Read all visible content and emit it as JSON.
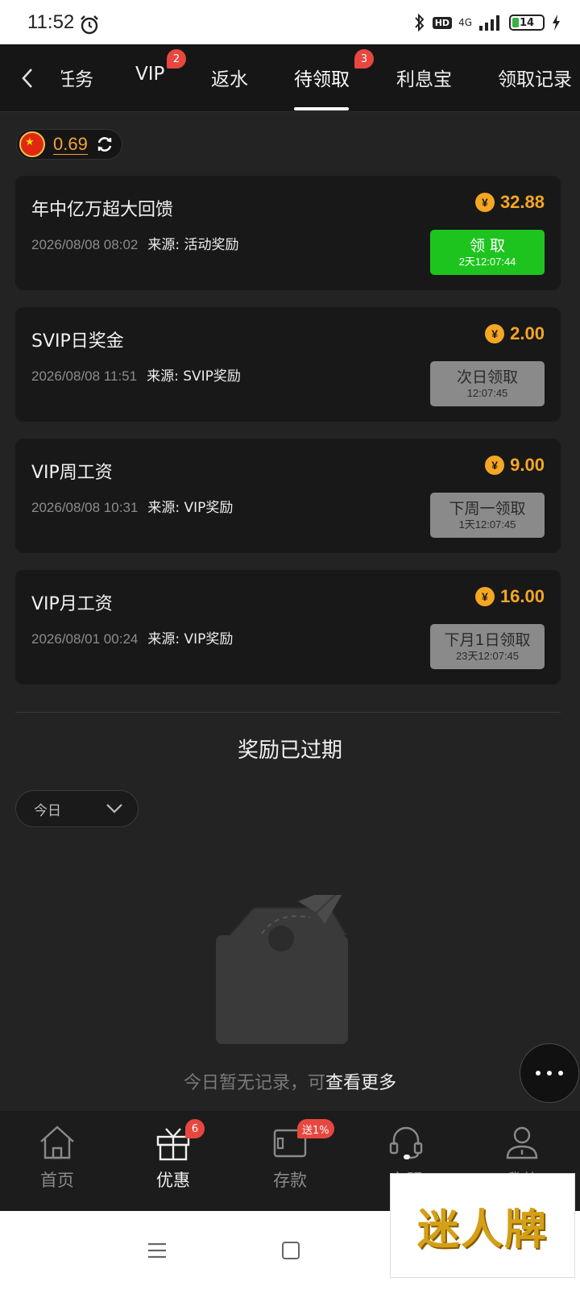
{
  "status_bar": {
    "time": "11:52",
    "network": "4G",
    "hd": "HD",
    "battery": "14"
  },
  "header": {
    "tabs": [
      {
        "label": "任务"
      },
      {
        "label": "VIP",
        "badge": "2"
      },
      {
        "label": "返水"
      },
      {
        "label": "待领取",
        "badge": "3",
        "active": true
      },
      {
        "label": "利息宝"
      },
      {
        "label": "领取记录"
      }
    ]
  },
  "balance": {
    "value": "0.69"
  },
  "rewards": [
    {
      "title": "年中亿万超大回馈",
      "date": "2026/08/08 08:02",
      "source": "来源: 活动奖励",
      "amount": "32.88",
      "button_label": "领 取",
      "button_timer": "2天12:07:44",
      "state": "active"
    },
    {
      "title": "SVIP日奖金",
      "date": "2026/08/08 11:51",
      "source": "来源: SVIP奖励",
      "amount": "2.00",
      "button_label": "次日领取",
      "button_timer": "12:07:45",
      "state": "disabled"
    },
    {
      "title": "VIP周工资",
      "date": "2026/08/08 10:31",
      "source": "来源: VIP奖励",
      "amount": "9.00",
      "button_label": "下周一领取",
      "button_timer": "1天12:07:45",
      "state": "disabled"
    },
    {
      "title": "VIP月工资",
      "date": "2026/08/01 00:24",
      "source": "来源: VIP奖励",
      "amount": "16.00",
      "button_label": "下月1日领取",
      "button_timer": "23天12:07:45",
      "state": "disabled"
    }
  ],
  "expired": {
    "title": "奖励已过期",
    "filter_value": "今日",
    "empty_text": "今日暂无记录，可",
    "empty_link": "查看更多"
  },
  "bottom_nav": [
    {
      "label": "首页",
      "icon": "home-icon"
    },
    {
      "label": "优惠",
      "icon": "gift-icon",
      "badge": "6",
      "active": true
    },
    {
      "label": "存款",
      "icon": "wallet-icon",
      "badge": "送1%"
    },
    {
      "label": "客服",
      "icon": "headset-icon"
    },
    {
      "label": "我的",
      "icon": "user-icon"
    }
  ],
  "watermark": {
    "text": "迷人牌"
  },
  "colors": {
    "accent_gold": "#f5a623",
    "claim_green": "#1ec41e",
    "badge_red": "#e8473f",
    "background": "#232323"
  }
}
